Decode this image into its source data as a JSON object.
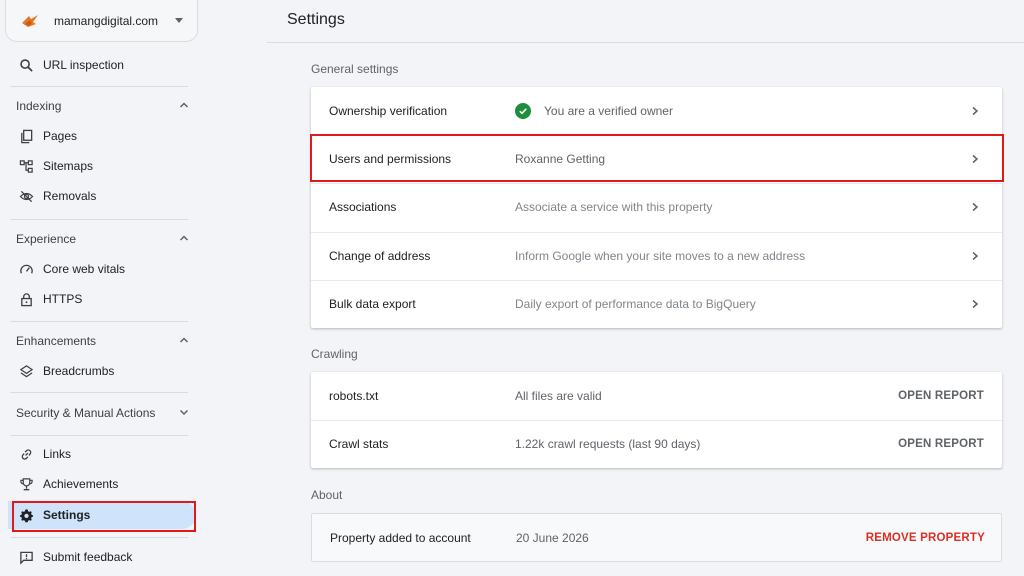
{
  "sidebar": {
    "property": "mamangdigital.com",
    "url_inspection": "URL inspection",
    "indexing": {
      "heading": "Indexing",
      "items": [
        "Pages",
        "Sitemaps",
        "Removals"
      ]
    },
    "experience": {
      "heading": "Experience",
      "items": [
        "Core web vitals",
        "HTTPS"
      ]
    },
    "enhancements": {
      "heading": "Enhancements",
      "items": [
        "Breadcrumbs"
      ]
    },
    "security": {
      "heading": "Security & Manual Actions"
    },
    "links": "Links",
    "achievements": "Achievements",
    "settings": "Settings",
    "submit_feedback": "Submit feedback"
  },
  "main": {
    "title": "Settings",
    "general": {
      "heading": "General settings",
      "rows": [
        {
          "label": "Ownership verification",
          "value": "You are a verified owner"
        },
        {
          "label": "Users and permissions",
          "value": "Roxanne Getting"
        },
        {
          "label": "Associations",
          "value": "Associate a service with this property"
        },
        {
          "label": "Change of address",
          "value": "Inform Google when your site moves to a new address"
        },
        {
          "label": "Bulk data export",
          "value": "Daily export of performance data to BigQuery"
        }
      ]
    },
    "crawling": {
      "heading": "Crawling",
      "rows": [
        {
          "label": "robots.txt",
          "value": "All files are valid",
          "action": "OPEN REPORT"
        },
        {
          "label": "Crawl stats",
          "value": "1.22k crawl requests (last 90 days)",
          "action": "OPEN REPORT"
        }
      ]
    },
    "about": {
      "heading": "About",
      "rows": [
        {
          "label": "Property added to account",
          "value": "20 June 2026",
          "action": "REMOVE PROPERTY"
        }
      ]
    }
  },
  "colors": {
    "active_bg": "#cfe4fb",
    "highlight": "#e01a1a",
    "verified": "#1e8e3e",
    "danger": "#d93025"
  }
}
